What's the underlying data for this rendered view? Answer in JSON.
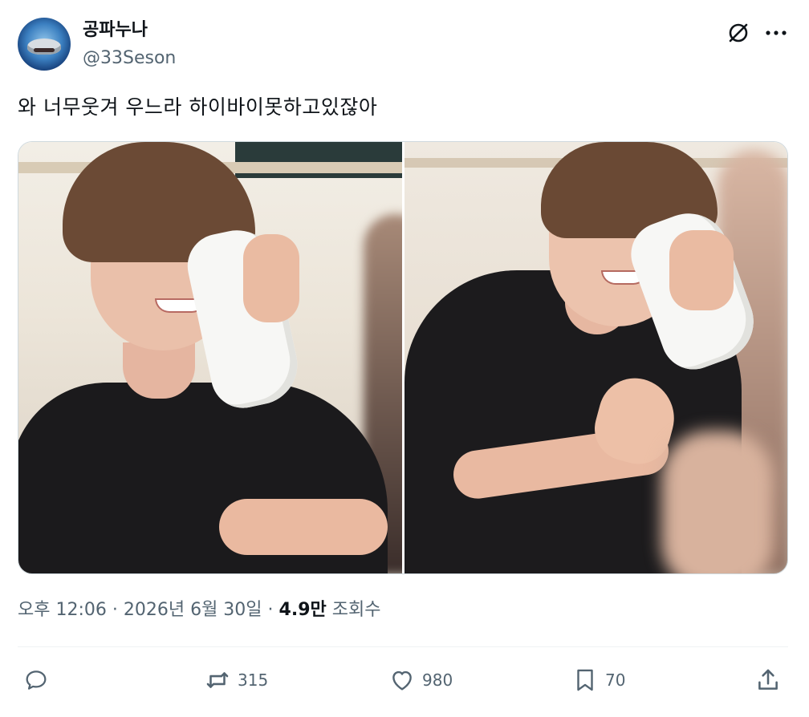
{
  "author": {
    "display_name": "공파누나",
    "handle": "@33Seson",
    "avatar_icon": "shark-avatar"
  },
  "header_actions": {
    "grok_icon": "grok-icon",
    "more_icon": "more-dots-icon"
  },
  "tweet": {
    "text": "와 너무웃겨 우느라 하이바이못하고있잖아"
  },
  "media": {
    "count": 2,
    "photos": [
      {
        "description_icon": "photo-left"
      },
      {
        "description_icon": "photo-right"
      }
    ]
  },
  "meta": {
    "time": "오후 12:06",
    "sep1": " · ",
    "date": "2026년 6월 30일",
    "sep2": " · ",
    "views_count": "4.9만",
    "views_label": " 조회수"
  },
  "actions": {
    "reply": {
      "icon": "reply-icon",
      "count": ""
    },
    "repost": {
      "icon": "repost-icon",
      "count": "315"
    },
    "like": {
      "icon": "heart-icon",
      "count": "980"
    },
    "bookmark": {
      "icon": "bookmark-icon",
      "count": "70"
    },
    "share": {
      "icon": "share-icon",
      "count": ""
    }
  },
  "colors": {
    "text_primary": "#0f1419",
    "text_secondary": "#536471",
    "border": "#cfd9de"
  }
}
